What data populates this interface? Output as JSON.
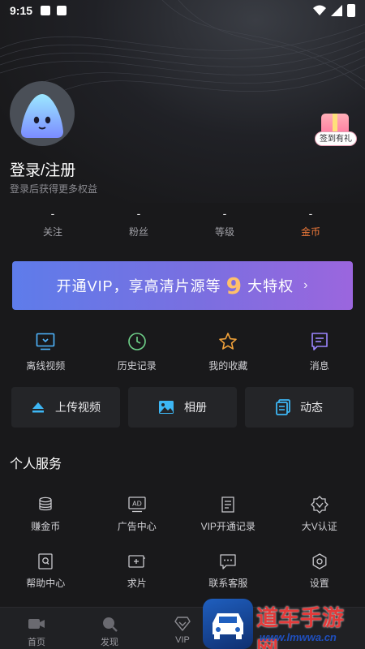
{
  "status_bar": {
    "time": "9:15"
  },
  "profile": {
    "login_title": "登录/注册",
    "login_subtitle": "登录后获得更多权益",
    "checkin_badge": "签到有礼"
  },
  "stats": [
    {
      "value": "-",
      "label": "关注"
    },
    {
      "value": "-",
      "label": "粉丝"
    },
    {
      "value": "-",
      "label": "等级"
    },
    {
      "value": "-",
      "label": "金币"
    }
  ],
  "vip_banner": {
    "text_before": "开通VIP，享高清片源等",
    "number": "9",
    "text_after": "大特权",
    "chevron": "›"
  },
  "quick_actions": [
    {
      "label": "离线视频",
      "icon": "download-screen-icon"
    },
    {
      "label": "历史记录",
      "icon": "clock-icon"
    },
    {
      "label": "我的收藏",
      "icon": "star-icon"
    },
    {
      "label": "消息",
      "icon": "message-icon"
    }
  ],
  "action_buttons": [
    {
      "label": "上传视频",
      "icon": "upload-icon"
    },
    {
      "label": "相册",
      "icon": "photo-icon"
    },
    {
      "label": "动态",
      "icon": "feed-icon"
    }
  ],
  "section_title": "个人服务",
  "services": [
    {
      "label": "赚金币",
      "icon": "coins-icon"
    },
    {
      "label": "广告中心",
      "icon": "ad-icon"
    },
    {
      "label": "VIP开通记录",
      "icon": "record-icon"
    },
    {
      "label": "大V认证",
      "icon": "verify-icon"
    },
    {
      "label": "帮助中心",
      "icon": "help-icon"
    },
    {
      "label": "求片",
      "icon": "request-film-icon"
    },
    {
      "label": "联系客服",
      "icon": "chat-icon"
    },
    {
      "label": "设置",
      "icon": "gear-icon"
    }
  ],
  "tab_bar": [
    {
      "label": "首页",
      "icon": "camera-icon"
    },
    {
      "label": "发现",
      "icon": "compass-icon"
    },
    {
      "label": "VIP",
      "icon": "diamond-icon"
    }
  ],
  "watermark": {
    "text": "道车手游网",
    "url": "www.lmwwa.cn"
  },
  "colors": {
    "accent_coin": "#f07a3a",
    "banner_start": "#5e7cea",
    "banner_end": "#9b66de",
    "icon_blue": "#4fb6ff",
    "icon_green": "#6fd28a",
    "icon_orange": "#f2a23a",
    "icon_purple": "#9c86ff"
  }
}
